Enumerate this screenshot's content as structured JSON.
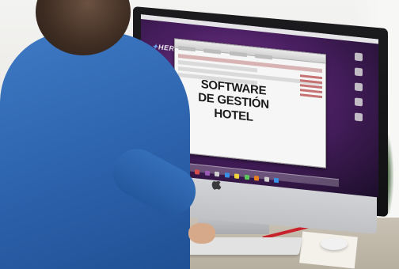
{
  "screen": {
    "headline": [
      "SOFTWARE",
      "DE GESTIÓN",
      "HOTEL"
    ]
  },
  "brand": {
    "text": "HER"
  },
  "icons": {
    "device_logo": "apple-logo-icon"
  },
  "colors": {
    "shirt": "#2f66b0",
    "wallpaper": "#4a1f62",
    "pen": "#c8232c"
  }
}
